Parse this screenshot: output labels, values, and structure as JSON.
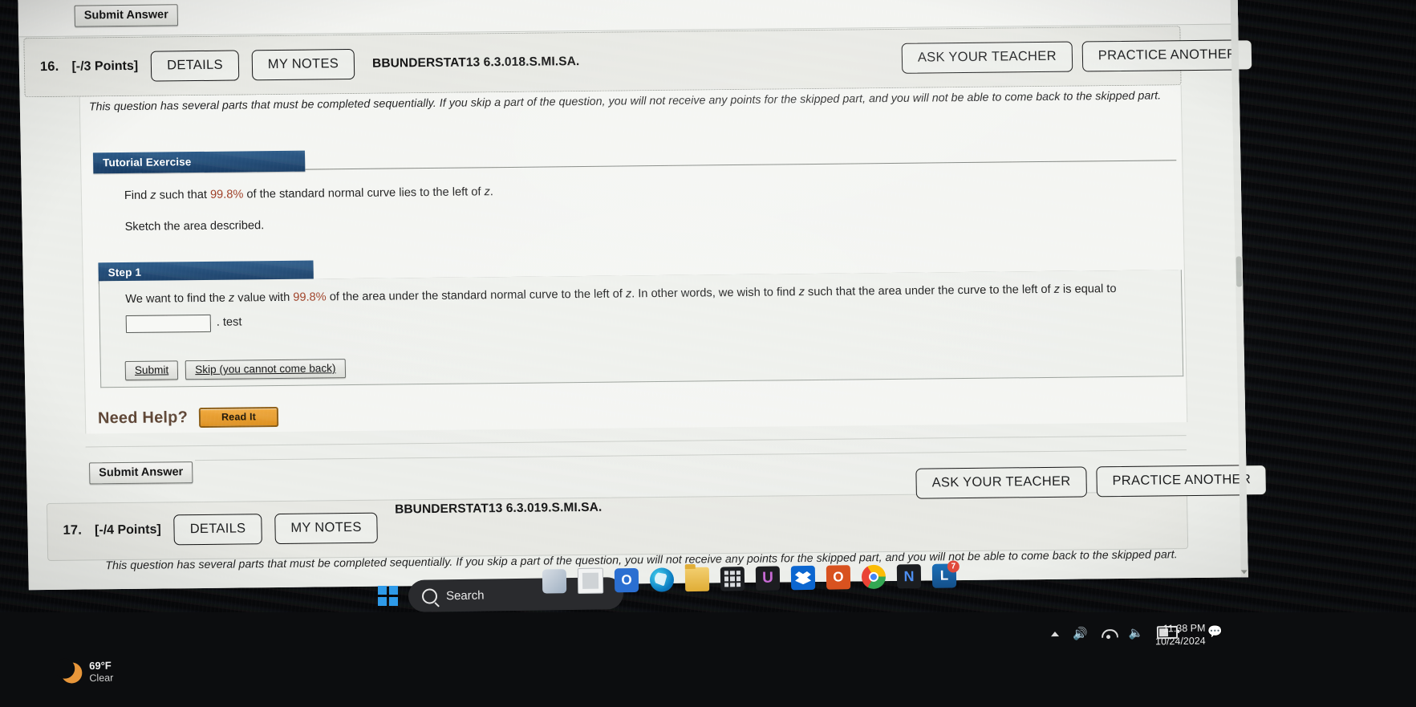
{
  "top_partial": {
    "submit_answer_label": "Submit Answer"
  },
  "question16": {
    "number": "16.",
    "points": "[-/3 Points]",
    "details_label": "DETAILS",
    "my_notes_label": "MY NOTES",
    "code": "BBUNDERSTAT13 6.3.018.S.MI.SA.",
    "ask_teacher_label": "ASK YOUR TEACHER",
    "practice_another_label": "PRACTICE ANOTHER",
    "intro": "This question has several parts that must be completed sequentially. If you skip a part of the question, you will not receive any points for the skipped part, and you will not be able to come back to the skipped part.",
    "tutorial": {
      "banner": "Tutorial Exercise",
      "prompt_before": "Find ",
      "prompt_z": "z",
      "prompt_mid": " such that ",
      "prompt_pct": "99.8%",
      "prompt_after": " of the standard normal curve lies to the left of ",
      "prompt_end": ".",
      "sketch_line": "Sketch the area described."
    },
    "step1": {
      "banner": "Step 1",
      "text_a": "We want to find the ",
      "text_z1": "z",
      "text_b": " value with ",
      "text_pct": "99.8%",
      "text_c": " of the area under the standard normal curve to the left of ",
      "text_z2": "z",
      "text_d": ". In other words, we wish to find ",
      "text_z3": "z",
      "text_e": " such that the area under the curve to the left of ",
      "text_z4": "z",
      "text_f": " is equal to",
      "input_value": "",
      "input_placeholder": "",
      "after_input": ". test",
      "submit_label": "Submit",
      "skip_label": "Skip (you cannot come back)"
    },
    "need_help_label": "Need Help?",
    "read_it_label": "Read It",
    "submit_answer_label": "Submit Answer"
  },
  "question17": {
    "number": "17.",
    "points": "[-/4 Points]",
    "details_label": "DETAILS",
    "my_notes_label": "MY NOTES",
    "code": "BBUNDERSTAT13 6.3.019.S.MI.SA.",
    "ask_teacher_label": "ASK YOUR TEACHER",
    "practice_another_label": "PRACTICE ANOTHER",
    "intro": "This question has several parts that must be completed sequentially. If you skip a part of the question, you will not receive any points for the skipped part, and you will not be able to come back to the skipped part."
  },
  "taskbar": {
    "weather_temp": "69°F",
    "weather_cond": "Clear",
    "start_icon": "windows-start-icon",
    "search_placeholder": "Search",
    "apps": [
      {
        "name": "snipping-tool-icon"
      },
      {
        "name": "notepad-icon"
      },
      {
        "name": "outlook-icon"
      },
      {
        "name": "edge-icon"
      },
      {
        "name": "file-explorer-icon"
      },
      {
        "name": "app-grid-icon"
      },
      {
        "name": "ulearn-icon"
      },
      {
        "name": "dropbox-icon"
      },
      {
        "name": "office-icon"
      },
      {
        "name": "chrome-icon"
      },
      {
        "name": "teams-icon"
      },
      {
        "name": "lockdown-browser-icon",
        "badge": "7"
      }
    ],
    "tray": {
      "chevron": "show-hidden-icons",
      "sound": "speaker-icon",
      "wifi": "wifi-icon",
      "volume": "volume-icon",
      "battery": "battery-icon"
    },
    "clock_time": "11:38 PM",
    "clock_date": "10/24/2024",
    "notifications_icon": "notification-bell-icon"
  },
  "colors": {
    "banner_blue": "#1d4a78",
    "highlight_red": "#9c3b22",
    "readit_orange": "#e59a2c",
    "taskbar_dark": "#0c0d0f"
  }
}
